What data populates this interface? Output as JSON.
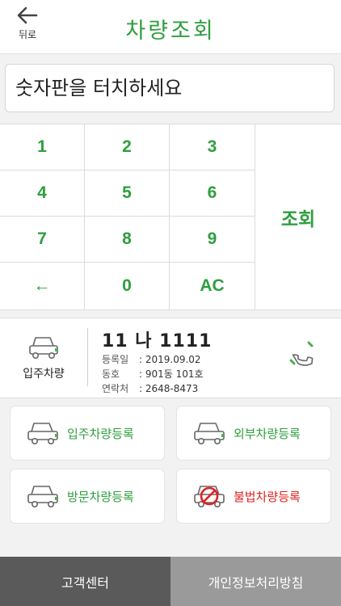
{
  "header": {
    "back_label": "뒤로",
    "title": "차량조회"
  },
  "input": {
    "placeholder": "숫자판을 터치하세요"
  },
  "keypad": {
    "keys": [
      "1",
      "2",
      "3",
      "4",
      "5",
      "6",
      "7",
      "8",
      "9",
      "←",
      "0",
      "AC"
    ],
    "search_label": "조회"
  },
  "result": {
    "car_type": "입주차량",
    "plate": "11 나 1111",
    "reg_date_label": "등록일",
    "reg_date": ": 2019.09.02",
    "unit_label": "동호",
    "unit": ": 901동 101호",
    "contact_label": "연락처",
    "contact": ": 2648-8473"
  },
  "actions": {
    "resident": "입주차량등록",
    "external": "외부차량등록",
    "visitor": "방문차량등록",
    "illegal": "불법차량등록"
  },
  "footer": {
    "support": "고객센터",
    "privacy": "개인정보처리방침"
  },
  "colors": {
    "accent": "#2e9e3e",
    "danger": "#e02222"
  }
}
